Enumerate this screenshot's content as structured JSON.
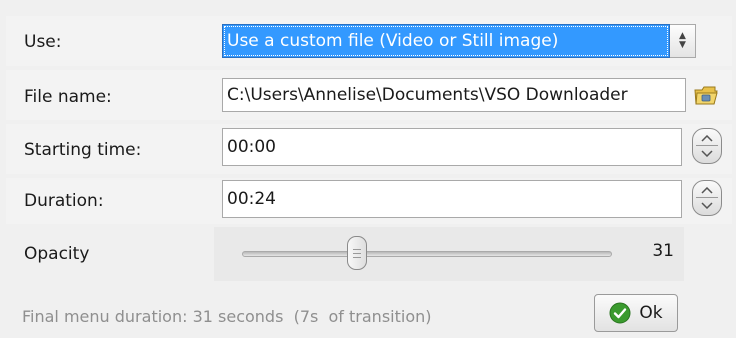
{
  "use": {
    "label": "Use:",
    "selected": "Use a custom file (Video or Still image)"
  },
  "file_name": {
    "label": "File name:",
    "value": "C:\\Users\\Annelise\\Documents\\VSO Downloader"
  },
  "starting_time": {
    "label": "Starting time:",
    "value": "00:00"
  },
  "duration": {
    "label": "Duration:",
    "value": "00:24"
  },
  "opacity": {
    "label": "Opacity",
    "value": "31",
    "level_percent": 31
  },
  "footer": {
    "summary": "Final menu duration: 31 seconds  (7s  of transition)",
    "ok_label": "Ok"
  },
  "colors": {
    "selection": "#3399ff",
    "ok_check": "#3a9a2e"
  }
}
